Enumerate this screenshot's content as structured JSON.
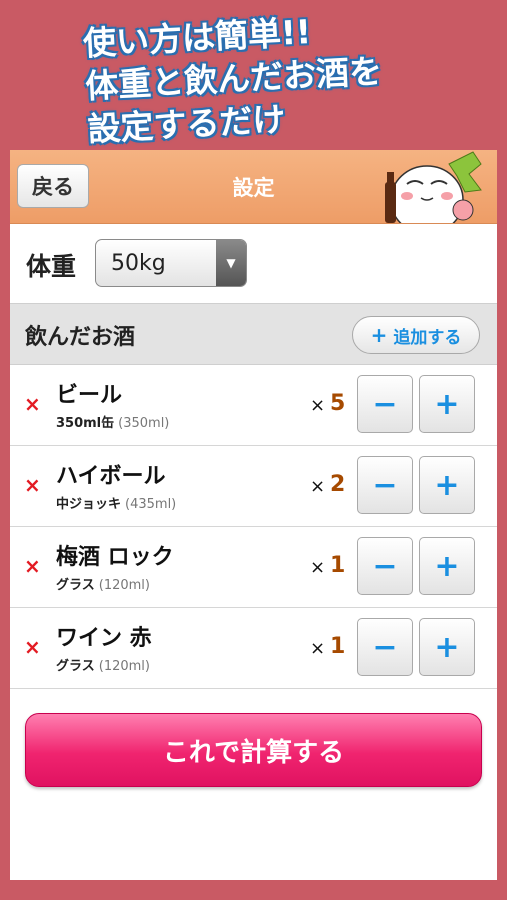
{
  "promo": {
    "line1": "使い方は簡単!!",
    "line2": "体重と飲んだお酒を",
    "line3": "設定するだけ"
  },
  "navbar": {
    "back_label": "戻る",
    "title": "設定",
    "mascot_icon": "sake-mascot-icon"
  },
  "weight": {
    "label": "体重",
    "value": "50kg",
    "arrow": "▼"
  },
  "drinks": {
    "title": "飲んだお酒",
    "add_label": "追加する",
    "add_icon": "+",
    "delete_icon": "×",
    "times_symbol": "×",
    "minus_symbol": "−",
    "plus_symbol": "+",
    "items": [
      {
        "name": "ビール",
        "unit": "350ml缶",
        "volume": "(350ml)",
        "count": "5"
      },
      {
        "name": "ハイボール",
        "unit": "中ジョッキ",
        "volume": "(435ml)",
        "count": "2"
      },
      {
        "name": "梅酒 ロック",
        "unit": "グラス",
        "volume": "(120ml)",
        "count": "1"
      },
      {
        "name": "ワイン 赤",
        "unit": "グラス",
        "volume": "(120ml)",
        "count": "1"
      }
    ]
  },
  "calculate_label": "これで計算する",
  "colors": {
    "background": "#c95a64",
    "navbar": "#ee9d67",
    "accent_blue": "#1a8fe0",
    "delete_red": "#e31b23",
    "count_brown": "#a64a00",
    "calc_button": "#f0246f"
  }
}
